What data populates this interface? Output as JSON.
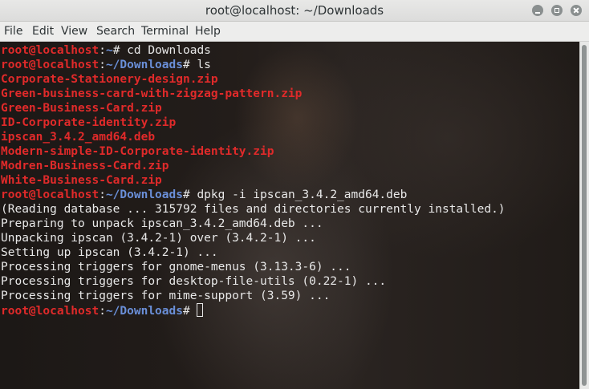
{
  "window": {
    "title": "root@localhost: ~/Downloads"
  },
  "menu": [
    "File",
    "Edit",
    "View",
    "Search",
    "Terminal",
    "Help"
  ],
  "prompt": {
    "user_host": "root@localhost",
    "colon": ":"
  },
  "lines": [
    {
      "type": "prompt",
      "path": "~",
      "symbol": "# ",
      "cmd": "cd Downloads"
    },
    {
      "type": "prompt",
      "path": "~/Downloads",
      "symbol": "# ",
      "cmd": "ls"
    },
    {
      "type": "file",
      "text": "Corporate-Stationery-design.zip"
    },
    {
      "type": "file",
      "text": "Green-business-card-with-zigzag-pattern.zip"
    },
    {
      "type": "file",
      "text": "Green-Business-Card.zip"
    },
    {
      "type": "file",
      "text": "ID-Corporate-identity.zip"
    },
    {
      "type": "file",
      "text": "ipscan_3.4.2_amd64.deb"
    },
    {
      "type": "file",
      "text": "Modern-simple-ID-Corporate-identity.zip"
    },
    {
      "type": "file",
      "text": "Modren-Business-Card.zip"
    },
    {
      "type": "file",
      "text": "White-Business-Card.zip"
    },
    {
      "type": "prompt",
      "path": "~/Downloads",
      "symbol": "# ",
      "cmd": "dpkg -i ipscan_3.4.2_amd64.deb"
    },
    {
      "type": "output",
      "text": "(Reading database ... 315792 files and directories currently installed.)"
    },
    {
      "type": "output",
      "text": "Preparing to unpack ipscan_3.4.2_amd64.deb ..."
    },
    {
      "type": "output",
      "text": "Unpacking ipscan (3.4.2-1) over (3.4.2-1) ..."
    },
    {
      "type": "output",
      "text": "Setting up ipscan (3.4.2-1) ..."
    },
    {
      "type": "output",
      "text": "Processing triggers for gnome-menus (3.13.3-6) ..."
    },
    {
      "type": "output",
      "text": "Processing triggers for desktop-file-utils (0.22-1) ..."
    },
    {
      "type": "output",
      "text": "Processing triggers for mime-support (3.59) ..."
    },
    {
      "type": "prompt",
      "path": "~/Downloads",
      "symbol": "# ",
      "cmd": "",
      "cursor": true
    }
  ],
  "colors": {
    "user": "#e02a2a",
    "path": "#6a8fd8",
    "file": "#e02a2a",
    "text": "#e8e8e8"
  }
}
